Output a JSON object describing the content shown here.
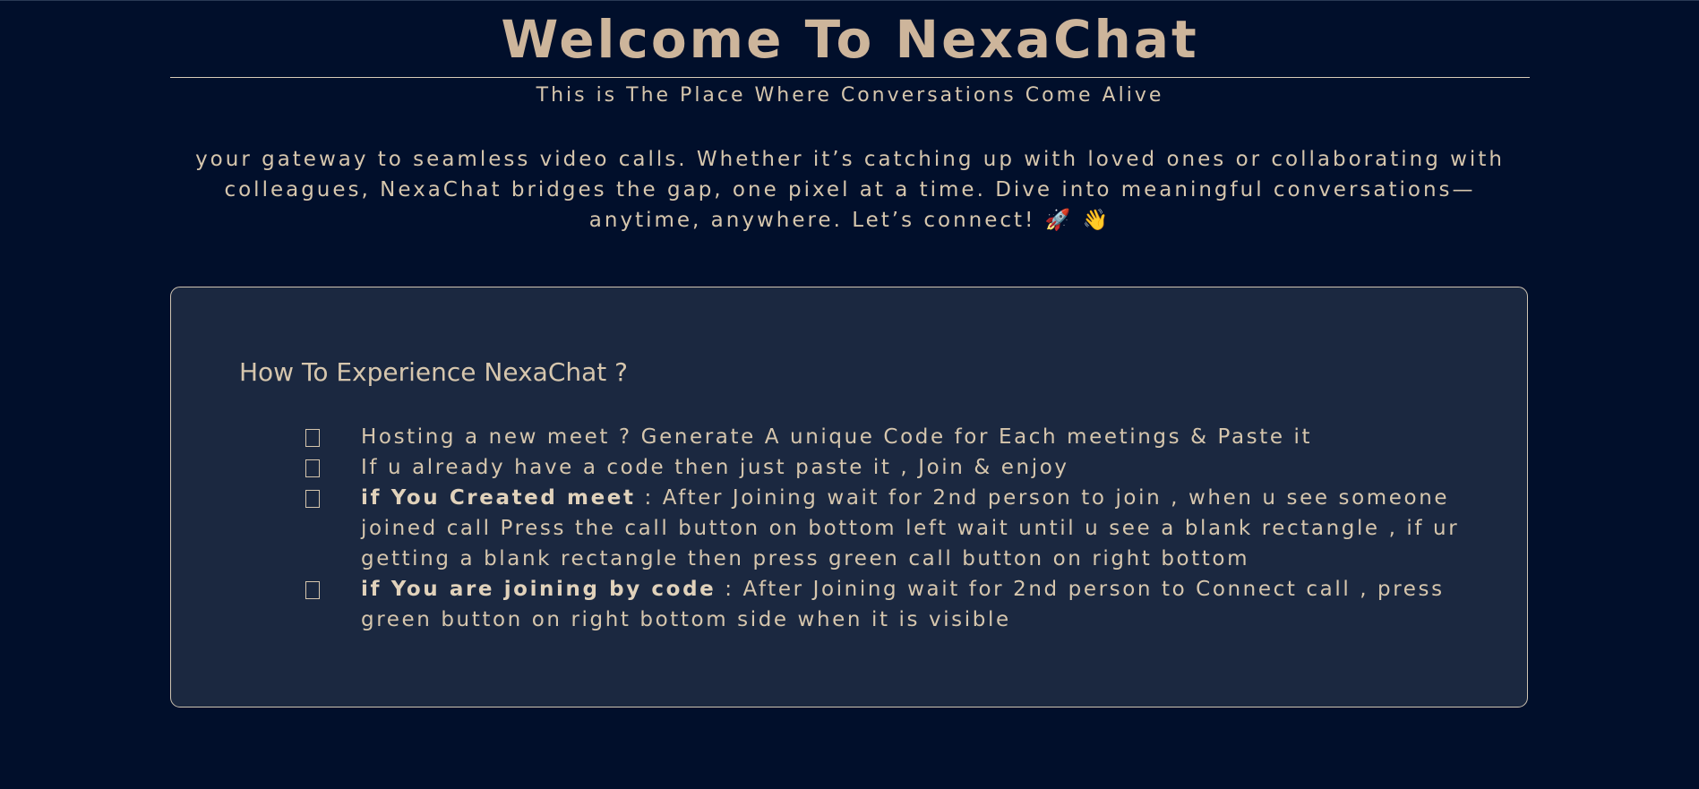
{
  "hero": {
    "title": "Welcome To NexaChat",
    "subtitle": "This is The Place Where Conversations Come Alive",
    "intro": "your gateway to seamless video calls. Whether it’s catching up with loved ones or collaborating with colleagues, NexaChat bridges the gap, one pixel at a time. Dive into meaningful conversations—anytime, anywhere. Let’s connect! 🚀 👋"
  },
  "card": {
    "heading": "How To Experience NexaChat ?",
    "steps": [
      {
        "bold": "",
        "text": "Hosting a new meet ? Generate A unique Code for Each meetings & Paste it"
      },
      {
        "bold": "",
        "text": "If u already have a code then just paste it , Join & enjoy"
      },
      {
        "bold": "if You Created meet",
        "text": " : After Joining wait for 2nd person to join , when u see someone joined call Press the call button on bottom left wait until u see a blank rectangle , if ur getting a blank rectangle then press green call button on right bottom"
      },
      {
        "bold": "if You are joining by code",
        "text": " : After Joining wait for 2nd person to Connect call , press green button on right bottom side when it is visible"
      }
    ]
  },
  "colors": {
    "background": "#010f2b",
    "card": "#1b2840",
    "text": "#cdb59b"
  }
}
